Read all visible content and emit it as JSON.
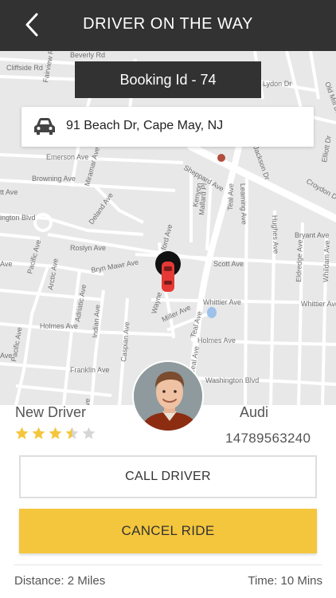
{
  "header": {
    "title": "DRIVER ON THE WAY",
    "back_icon": "chevron-left-icon"
  },
  "booking": {
    "label": "Booking Id - 74"
  },
  "address": {
    "icon": "car-icon",
    "text": "91 Beach Dr, Cape May, NJ"
  },
  "map": {
    "streets": [
      "Beverly Rd",
      "Cliffside Rd",
      "Fairview Rd",
      "Emerson Ave",
      "Browning Ave",
      "Miramar Ave",
      "Kenyon",
      "Sheppard Ave",
      "Mallard Pl",
      "Teal Ave",
      "Leaming Ave",
      "Hughes Ave",
      "Bryant Ave",
      "Eldredge Ave",
      "Whildam Ave",
      "Deland Ave",
      "Roslyn Ave",
      "Bryn Mawr Ave",
      "Arctic Ave",
      "Adriatic Ave",
      "Pacific Ave",
      "Scott Ave",
      "Whittier Ave",
      "Miller Ave",
      "Holmes Ave",
      "Indian Ave",
      "Caspian Ave",
      "Franklin Ave",
      "Washington Blvd",
      "Jackson St",
      "Croydon Dr",
      "Old Mill Dr",
      "Elliott Dr",
      "Lydon Dr",
      "Ington Blvd"
    ],
    "pin_color": "#e53935"
  },
  "driver": {
    "name": "New Driver",
    "car": "Audi",
    "phone": "14789563240",
    "rating": 3.5,
    "rating_max": 5,
    "star_color": "#f4c63d"
  },
  "actions": {
    "call_label": "CALL DRIVER",
    "cancel_label": "CANCEL RIDE",
    "cancel_color": "#f4c63d"
  },
  "trip": {
    "distance": "Distance: 2 Miles",
    "time": "Time: 10 Mins"
  }
}
